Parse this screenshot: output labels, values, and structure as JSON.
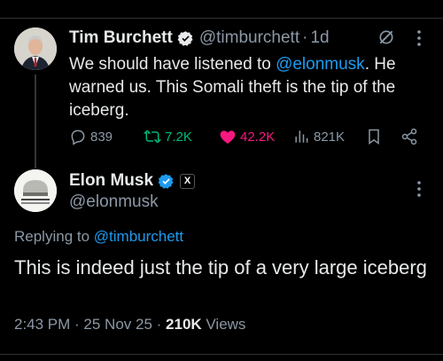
{
  "tweet1": {
    "author_name": "Tim Burchett",
    "handle": "@timburchett",
    "separator": "·",
    "time": "1d",
    "text_before": "We should have listened to ",
    "mention": "@elonmusk",
    "text_after": ". He warned us. This Somali theft is the tip of the iceberg.",
    "replies": "839",
    "reposts": "7.2K",
    "likes": "42.2K",
    "views": "821K",
    "icons": [
      "verified-badge-icon",
      "grok-icon",
      "more-icon",
      "reply-icon",
      "repost-icon",
      "like-icon",
      "views-icon",
      "bookmark-icon",
      "share-icon"
    ]
  },
  "tweet2": {
    "author_name": "Elon Musk",
    "handle": "@elonmusk",
    "badge": "X",
    "replying_prefix": "Replying to ",
    "replying_to": "@timburchett",
    "text": "This is indeed just the tip of a very large iceberg",
    "time": "2:43 PM",
    "date": "25 Nov 25",
    "views_count": "210K",
    "views_label": " Views",
    "sep": " · "
  },
  "colors": {
    "background": "#000000",
    "text": "#e7e9ea",
    "secondary": "#8b98a5",
    "link": "#1d9bf0",
    "repost": "#00ba7c",
    "like": "#f91880"
  }
}
